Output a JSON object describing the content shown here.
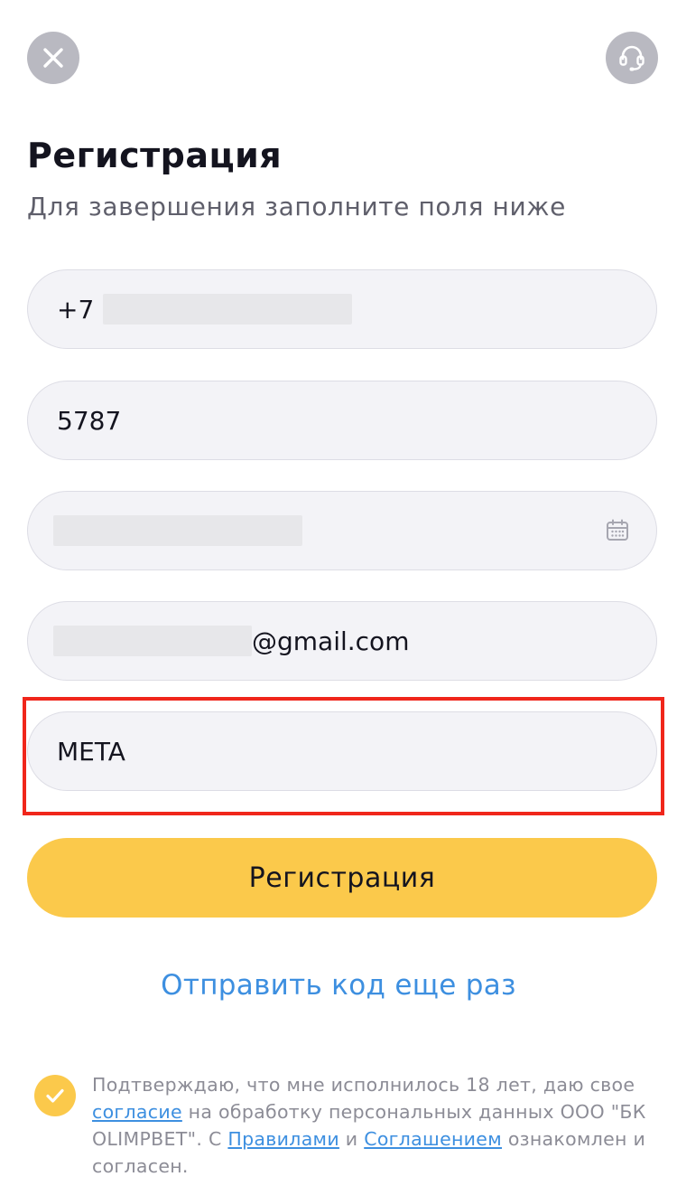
{
  "header": {
    "close_icon": "close-icon",
    "support_icon": "headset-icon"
  },
  "title": "Регистрация",
  "subtitle": "Для завершения заполните поля ниже",
  "form": {
    "phone_prefix": "+7",
    "code_value": "5787",
    "date_icon": "calendar-icon",
    "email_suffix": "@gmail.com",
    "promo_value": "META"
  },
  "register_button": "Регистрация",
  "resend_link": "Отправить код еще раз",
  "consent": {
    "checked": true,
    "text_1": "Подтверждаю, что мне исполнилось 18 лет, даю свое ",
    "link_consent": "согласие",
    "text_2": " на обработку персональных данных ООО \"БК OLIMPBET\". С ",
    "link_rules": "Правилами",
    "text_3": " и ",
    "link_agreement": "Соглашением",
    "text_4": " ознакомлен и согласен."
  },
  "colors": {
    "accent_yellow": "#fbc94b",
    "link_blue": "#3d8fe0",
    "highlight_red": "#f0261b",
    "field_bg": "#f3f3f7"
  }
}
